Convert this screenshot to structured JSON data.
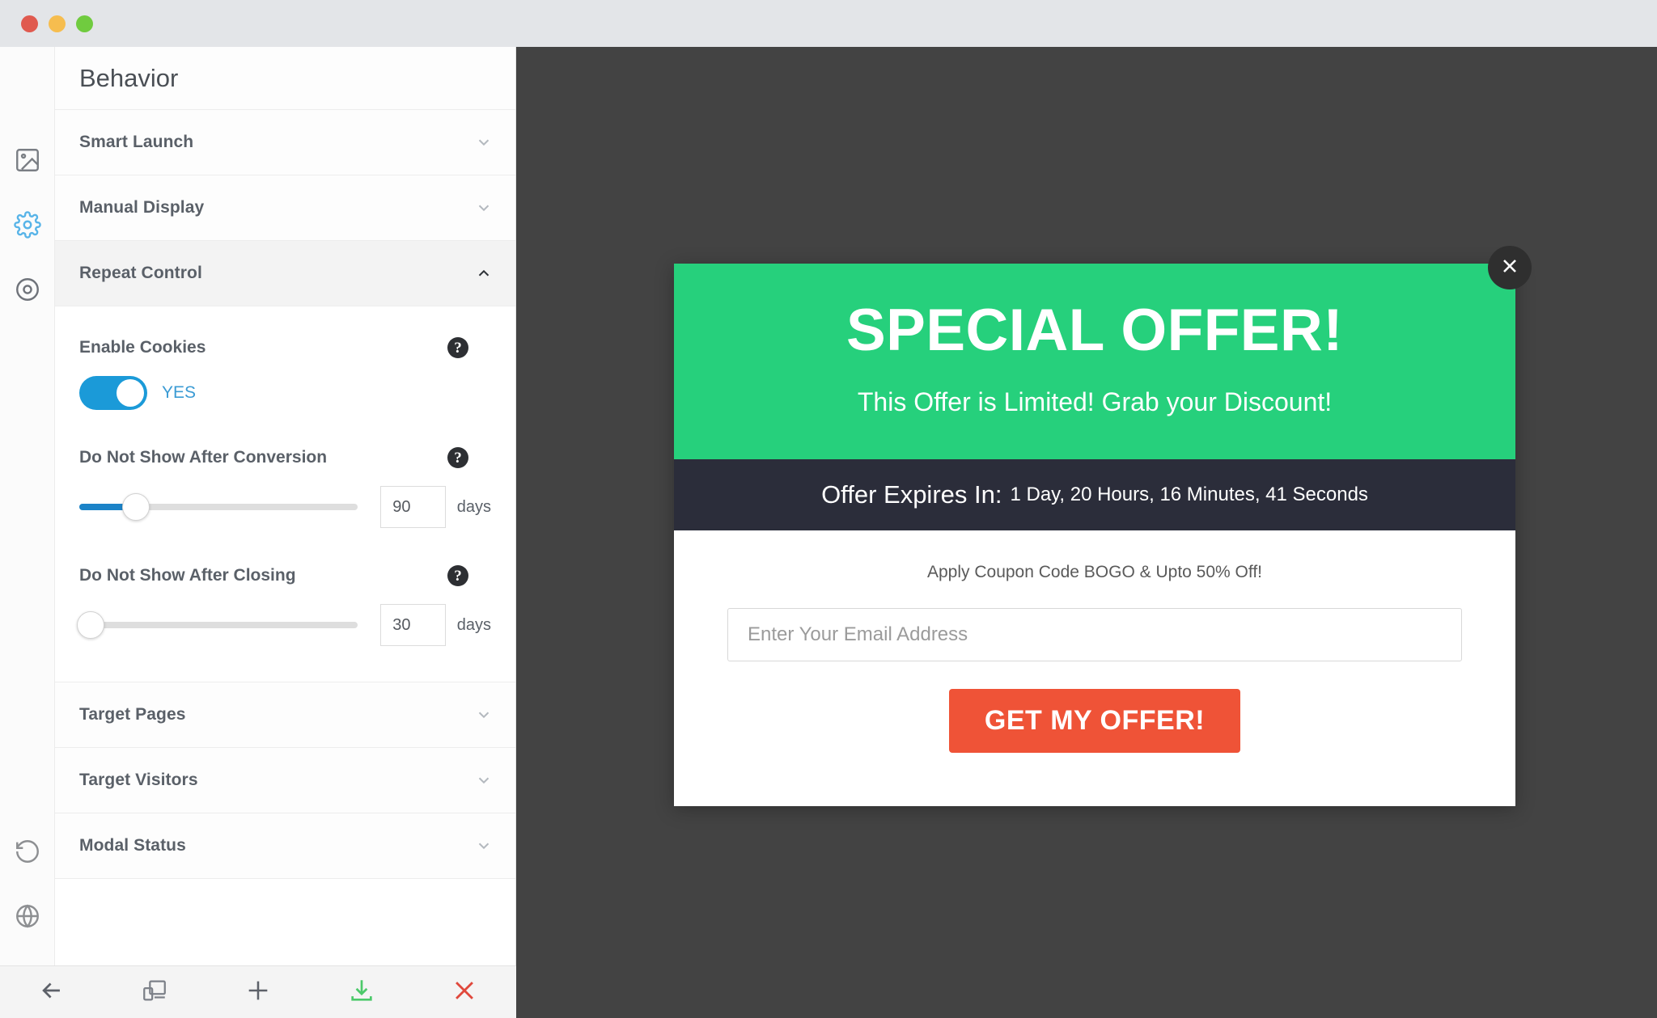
{
  "window": {
    "controls": [
      "close",
      "minimize",
      "maximize"
    ]
  },
  "rail": {
    "top_items": [
      {
        "name": "image-icon",
        "label": "Image"
      },
      {
        "name": "gear-icon",
        "label": "Settings"
      },
      {
        "name": "target-icon",
        "label": "Behavior"
      }
    ],
    "bottom_items": [
      {
        "name": "history-icon",
        "label": "History"
      },
      {
        "name": "globe-icon",
        "label": "Globe"
      }
    ]
  },
  "panel": {
    "title": "Behavior",
    "sections": [
      {
        "label": "Smart Launch",
        "open": false,
        "chevron": "chevron-down-icon"
      },
      {
        "label": "Manual Display",
        "open": false,
        "chevron": "chevron-down-icon"
      },
      {
        "label": "Repeat Control",
        "open": true,
        "chevron": "chevron-up-icon"
      }
    ],
    "trailing_sections": [
      {
        "label": "Target Pages",
        "open": false,
        "chevron": "chevron-down-icon"
      },
      {
        "label": "Target Visitors",
        "open": false,
        "chevron": "chevron-down-icon"
      },
      {
        "label": "Modal Status",
        "open": false,
        "chevron": "chevron-down-icon"
      }
    ],
    "repeat_control": {
      "enable_cookies": {
        "label": "Enable Cookies",
        "help": "?",
        "toggle_state": "on",
        "toggle_text": "YES"
      },
      "after_conversion": {
        "label": "Do Not Show After Conversion",
        "help": "?",
        "value": "90",
        "unit": "days",
        "slider_percent": 20
      },
      "after_closing": {
        "label": "Do Not Show After Closing",
        "help": "?",
        "value": "30",
        "unit": "days",
        "slider_percent": 4
      }
    }
  },
  "toolbar": {
    "buttons": [
      {
        "name": "back-arrow-icon",
        "label": "Back"
      },
      {
        "name": "responsive-preview-icon",
        "label": "Responsive"
      },
      {
        "name": "plus-icon",
        "label": "Add"
      },
      {
        "name": "download-icon",
        "label": "Save"
      },
      {
        "name": "close-x-icon",
        "label": "Close"
      }
    ]
  },
  "preview": {
    "modal": {
      "close_icon": "close-x-icon",
      "headline": "SPECIAL OFFER!",
      "subheadline": "This Offer is Limited! Grab your Discount!",
      "timer_label": "Offer Expires In:",
      "timer_value": "1 Day, 20 Hours, 16 Minutes, 41 Seconds",
      "coupon_text": "Apply Coupon Code BOGO & Upto 50% Off!",
      "email_placeholder": "Enter Your Email Address",
      "email_value": "",
      "cta_label": "GET MY OFFER!"
    }
  },
  "colors": {
    "accent_blue": "#1b9ad8",
    "modal_green": "#26d07c",
    "timer_dark": "#2b2d3a",
    "cta_orange": "#ef5337",
    "canvas_dark": "#434343"
  }
}
